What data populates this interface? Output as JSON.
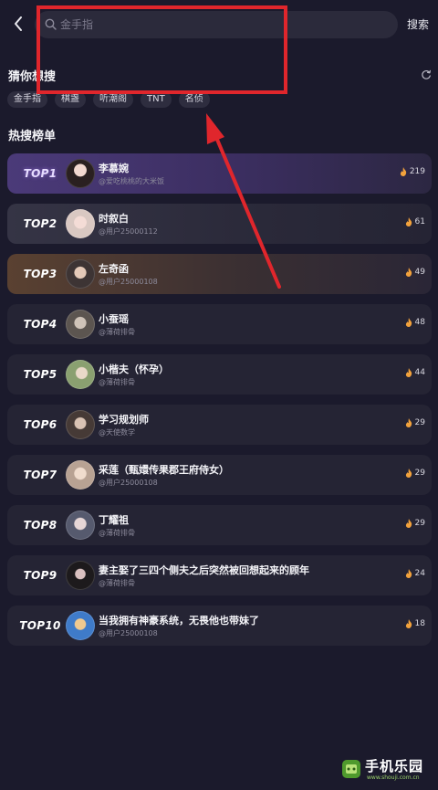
{
  "header": {
    "back_icon": "chevron-left-icon",
    "search_placeholder": "金手指",
    "search_button": "搜索"
  },
  "guess": {
    "title": "猜你想搜",
    "refresh_icon": "refresh-icon",
    "chips": [
      "金手指",
      "棋盏",
      "听潮阁",
      "TNT",
      "名侦"
    ]
  },
  "hot": {
    "title": "热搜榜单",
    "items": [
      {
        "rank": "TOP1",
        "name": "李慕婉",
        "author": "@爱吃桃桃的大米饭",
        "count": "219"
      },
      {
        "rank": "TOP2",
        "name": "时叙白",
        "author": "@用户25000112",
        "count": "61"
      },
      {
        "rank": "TOP3",
        "name": "左奇函",
        "author": "@用户25000108",
        "count": "49"
      },
      {
        "rank": "TOP4",
        "name": "小蚕瑶",
        "author": "@薄荷排骨",
        "count": "48"
      },
      {
        "rank": "TOP5",
        "name": "小楷夫（怀孕）",
        "author": "@薄荷排骨",
        "count": "44"
      },
      {
        "rank": "TOP6",
        "name": "学习规划师",
        "author": "@天使数学",
        "count": "29"
      },
      {
        "rank": "TOP7",
        "name": "采莲（甄嬛传果郡王府侍女）",
        "author": "@用户25000108",
        "count": "29"
      },
      {
        "rank": "TOP8",
        "name": "丁耀祖",
        "author": "@薄荷排骨",
        "count": "29"
      },
      {
        "rank": "TOP9",
        "name": "妻主娶了三四个侧夫之后突然被回想起来的顾年",
        "author": "@薄荷排骨",
        "count": "24"
      },
      {
        "rank": "TOP10",
        "name": "当我拥有神豪系统，无畏他也带妹了",
        "author": "@用户25000108",
        "count": "18"
      }
    ]
  },
  "watermark": {
    "text": "手机乐园",
    "url": "www.shouji.com.cn"
  },
  "colors": {
    "background": "#1b1a2c",
    "annotation": "#e0262c",
    "flame": "#f2a23c"
  }
}
